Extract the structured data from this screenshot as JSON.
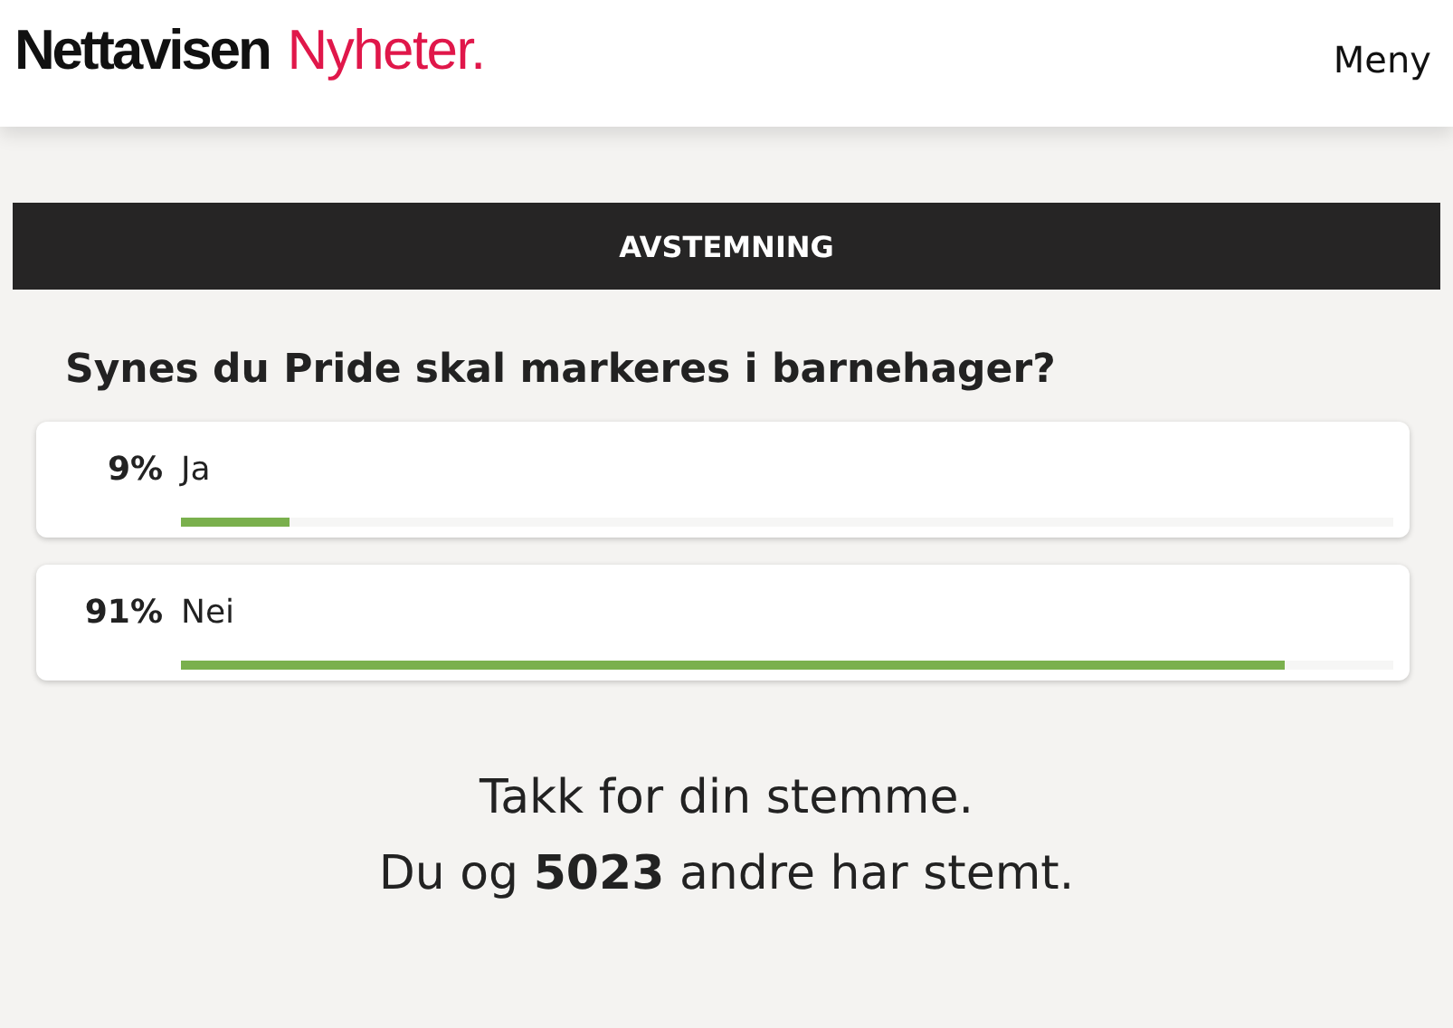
{
  "header": {
    "brand": "Nettavisen",
    "section": "Nyheter.",
    "menu": "Meny"
  },
  "poll": {
    "title": "AVSTEMNING",
    "question": "Synes du Pride skal markeres i barnehager?",
    "options": [
      {
        "percent": "9%",
        "label": "Ja",
        "level": 0.09
      },
      {
        "percent": "91%",
        "label": "Nei",
        "level": 0.91
      }
    ],
    "thanks": "Takk for din stemme.",
    "summary": "Du og **5023** andre har stemt."
  }
}
